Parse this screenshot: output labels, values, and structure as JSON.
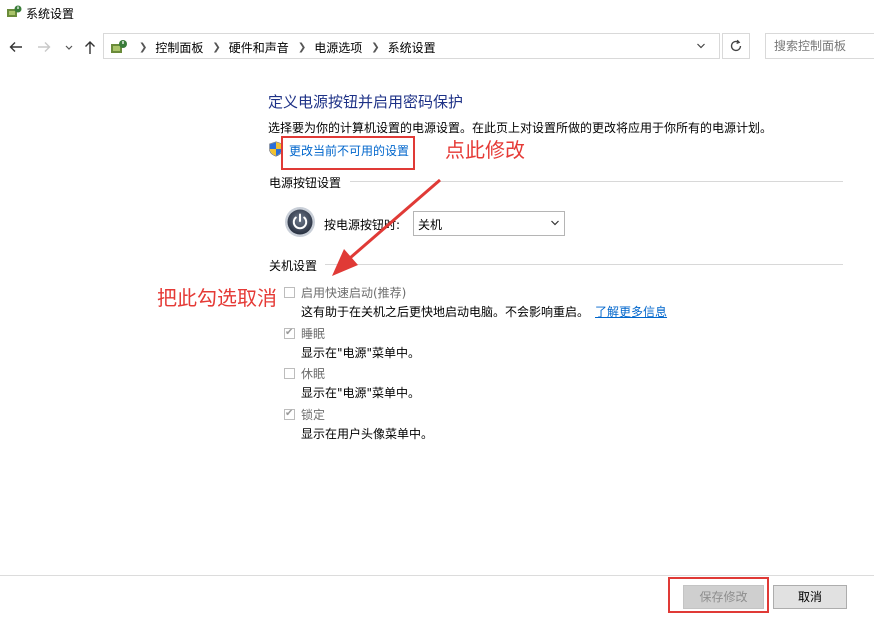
{
  "window": {
    "title": "系统设置"
  },
  "nav": {
    "back_icon": "arrow-left-icon",
    "forward_icon": "arrow-right-icon",
    "recent_icon": "chevron-down-icon",
    "up_icon": "arrow-up-icon",
    "breadcrumbs": [
      "控制面板",
      "硬件和声音",
      "电源选项",
      "系统设置"
    ],
    "refresh_icon": "refresh-icon",
    "search_placeholder": "搜索控制面板"
  },
  "main": {
    "title": "定义电源按钮并启用密码保护",
    "description": "选择要为你的计算机设置的电源设置。在此页上对设置所做的更改将应用于你所有的电源计划。",
    "change_link": "更改当前不可用的设置",
    "power_section": {
      "title": "电源按钮设置",
      "label": "按电源按钮时:",
      "selected_value": "关机"
    },
    "shutdown_section": {
      "title": "关机设置",
      "options": [
        {
          "label": "启用快速启动(推荐)",
          "checked": false,
          "desc": "这有助于在关机之后更快地启动电脑。不会影响重启。",
          "link": "了解更多信息"
        },
        {
          "label": "睡眠",
          "checked": true,
          "desc": "显示在\"电源\"菜单中。"
        },
        {
          "label": "休眠",
          "checked": false,
          "desc": "显示在\"电源\"菜单中。"
        },
        {
          "label": "锁定",
          "checked": true,
          "desc": "显示在用户头像菜单中。"
        }
      ]
    }
  },
  "annotations": {
    "click_here": "点此修改",
    "uncheck_here": "把此勾选取消",
    "color": "#e53a36"
  },
  "footer": {
    "save_label": "保存修改",
    "cancel_label": "取消"
  },
  "colors": {
    "title_blue": "#1e3287",
    "link_blue": "#0066cc",
    "annotation_red": "#e53a36"
  }
}
